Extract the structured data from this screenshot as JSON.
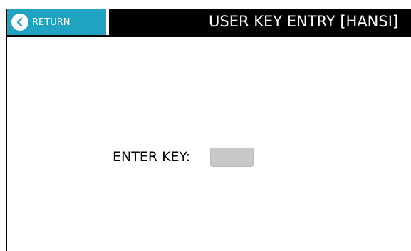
{
  "header": {
    "return_label": "RETURN",
    "title": "USER KEY ENTRY [HANSI]"
  },
  "form": {
    "enter_key_label": "ENTER KEY:",
    "key_value": ""
  },
  "icons": {
    "return": "chevron-left-circle-icon"
  },
  "colors": {
    "header_bg": "#000000",
    "return_button_bg": "#1fa3c0",
    "input_bg": "#c8c8c8"
  }
}
